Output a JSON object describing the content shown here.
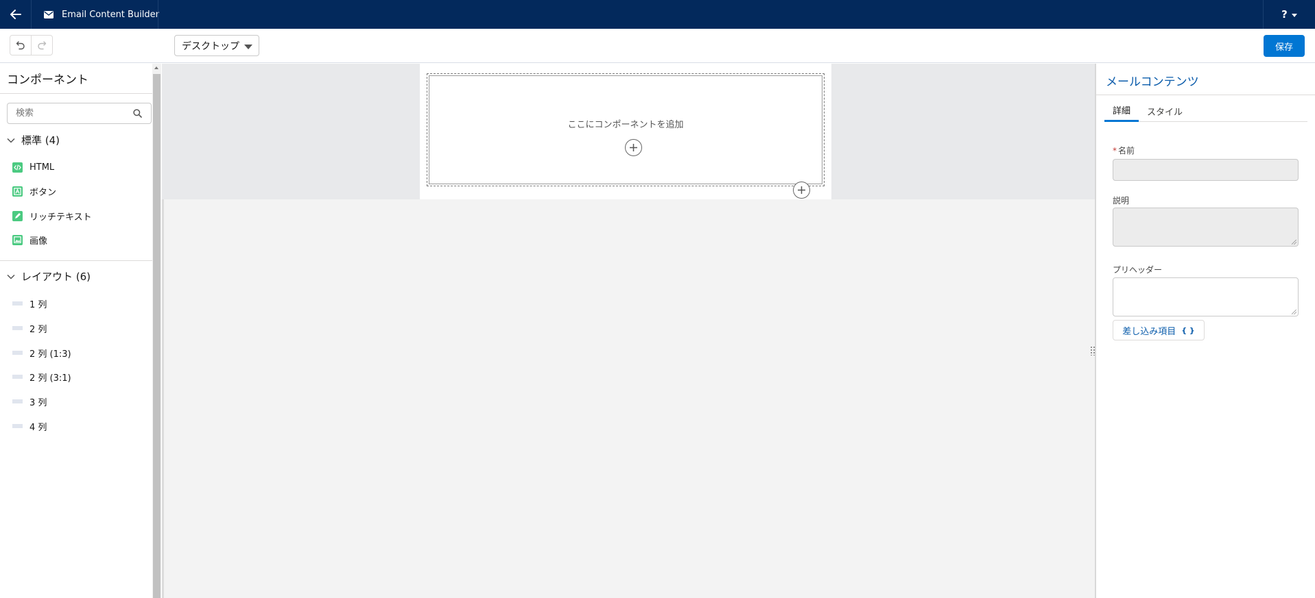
{
  "app": {
    "title": "Email Content Builder"
  },
  "header": {
    "help_label": "?"
  },
  "toolbar": {
    "view_select": "デスクトップ",
    "save_label": "保存"
  },
  "left_panel": {
    "title": "コンポーネント",
    "search_placeholder": "検索",
    "sections": [
      {
        "label": "標準 (4)",
        "items": [
          {
            "label": "HTML",
            "icon": "code-icon"
          },
          {
            "label": "ボタン",
            "icon": "button-icon"
          },
          {
            "label": "リッチテキスト",
            "icon": "pencil-icon"
          },
          {
            "label": "画像",
            "icon": "image-icon"
          }
        ]
      },
      {
        "label": "レイアウト (6)",
        "items": [
          {
            "label": "1 列"
          },
          {
            "label": "2 列"
          },
          {
            "label": "2 列 (1:3)"
          },
          {
            "label": "2 列 (3:1)"
          },
          {
            "label": "3 列"
          },
          {
            "label": "4 列"
          }
        ]
      }
    ]
  },
  "canvas": {
    "dropzone_text": "ここにコンポーネントを追加"
  },
  "right_panel": {
    "title": "メールコンテンツ",
    "tabs": [
      {
        "label": "詳細"
      },
      {
        "label": "スタイル"
      }
    ],
    "fields": {
      "name_label": "名前",
      "name_value": "",
      "description_label": "説明",
      "preheader_label": "プリヘッダー"
    },
    "merge_button": {
      "label": "差し込み項目",
      "bracket": "{ }"
    }
  },
  "colors": {
    "header_bg": "#03295c",
    "accent": "#0176d3",
    "component_icon": "#4bca81"
  }
}
